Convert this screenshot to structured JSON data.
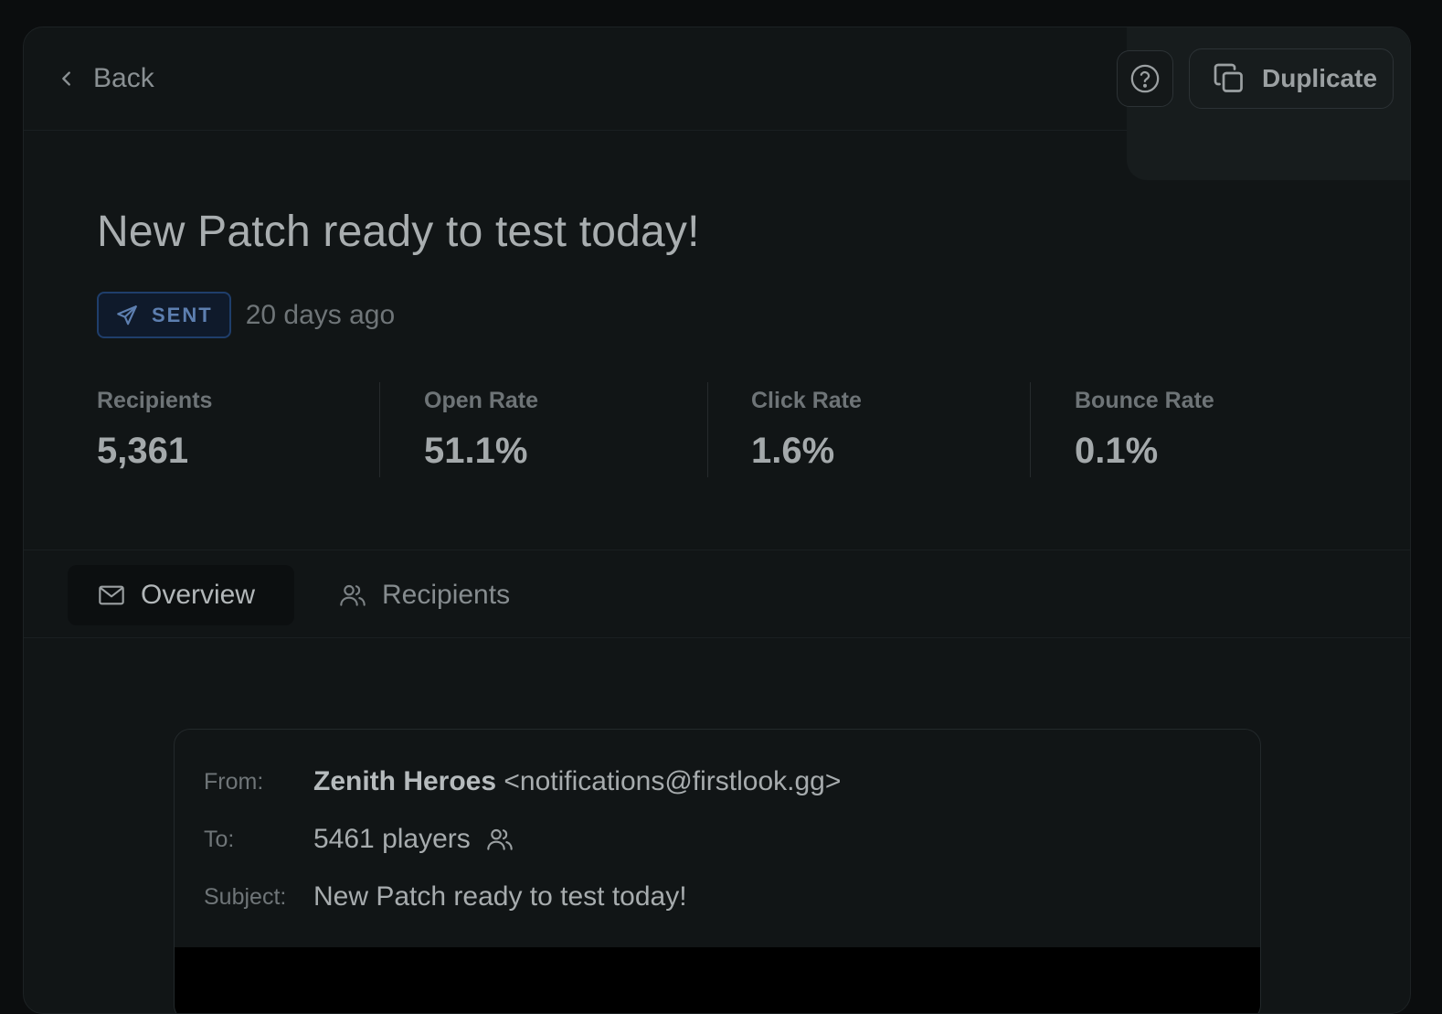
{
  "topbar": {
    "back_label": "Back",
    "duplicate_label": "Duplicate"
  },
  "campaign": {
    "title": "New Patch ready to test today!",
    "status": "SENT",
    "sent_time": "20 days ago"
  },
  "stats": [
    {
      "label": "Recipients",
      "value": "5,361"
    },
    {
      "label": "Open Rate",
      "value": "51.1%"
    },
    {
      "label": "Click Rate",
      "value": "1.6%"
    },
    {
      "label": "Bounce Rate",
      "value": "0.1%"
    }
  ],
  "tabs": [
    {
      "label": "Overview",
      "icon": "mail-icon",
      "active": true
    },
    {
      "label": "Recipients",
      "icon": "users-icon",
      "active": false
    }
  ],
  "email": {
    "from_label": "From:",
    "from_name": "Zenith Heroes",
    "from_address": "<notifications@firstlook.gg>",
    "to_label": "To:",
    "to_value": "5461 players",
    "subject_label": "Subject:",
    "subject_value": "New Patch ready to test today!"
  },
  "colors": {
    "background": "#0b0d0e",
    "panel": "#111516",
    "badge_border": "#1f3e6b",
    "badge_text": "#5d7fb0"
  }
}
